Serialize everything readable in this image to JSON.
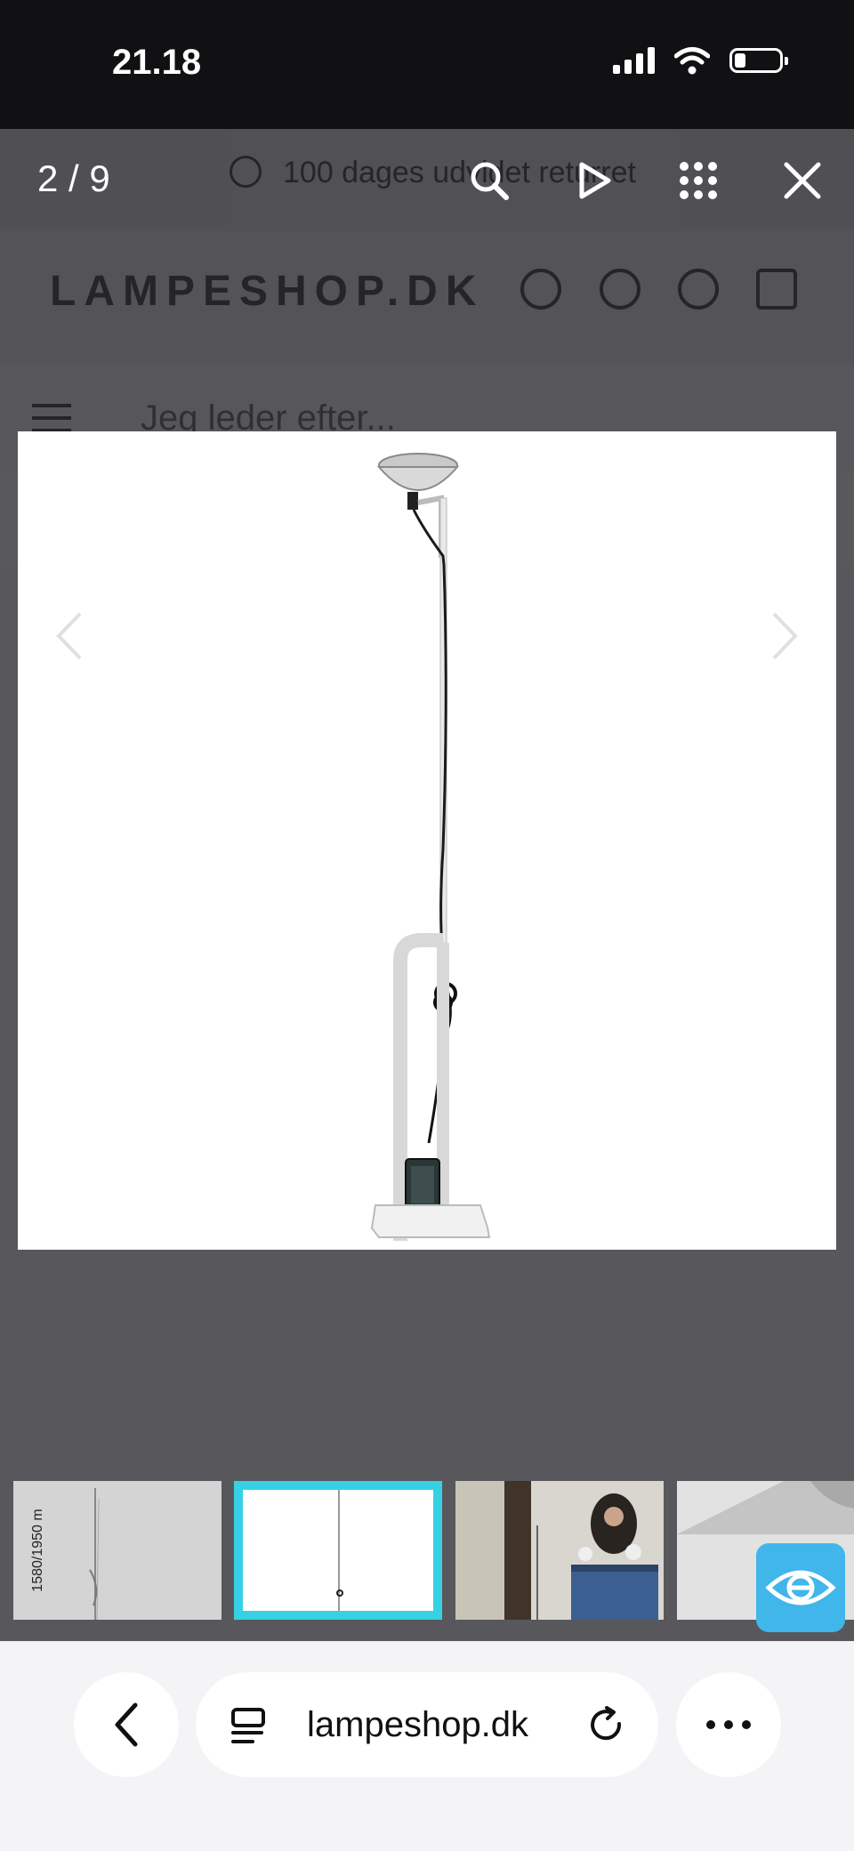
{
  "status_bar": {
    "time": "21.18"
  },
  "lightbox": {
    "counter": "2 / 9",
    "icons": [
      "search-icon",
      "play-icon",
      "grid-icon",
      "close-icon"
    ]
  },
  "background_page": {
    "banner_text": "100 dages udvidet returret",
    "logo": "LAMPESHOP.DK",
    "search_placeholder": "Jeg leder efter..."
  },
  "thumbnails": {
    "items": [
      {
        "label": "1580/1950 m"
      },
      {
        "label": ""
      },
      {
        "label": ""
      },
      {
        "label": ""
      }
    ],
    "active_index": 1,
    "accent_color": "#36d2e4"
  },
  "browser": {
    "url": "lampeshop.dk"
  }
}
